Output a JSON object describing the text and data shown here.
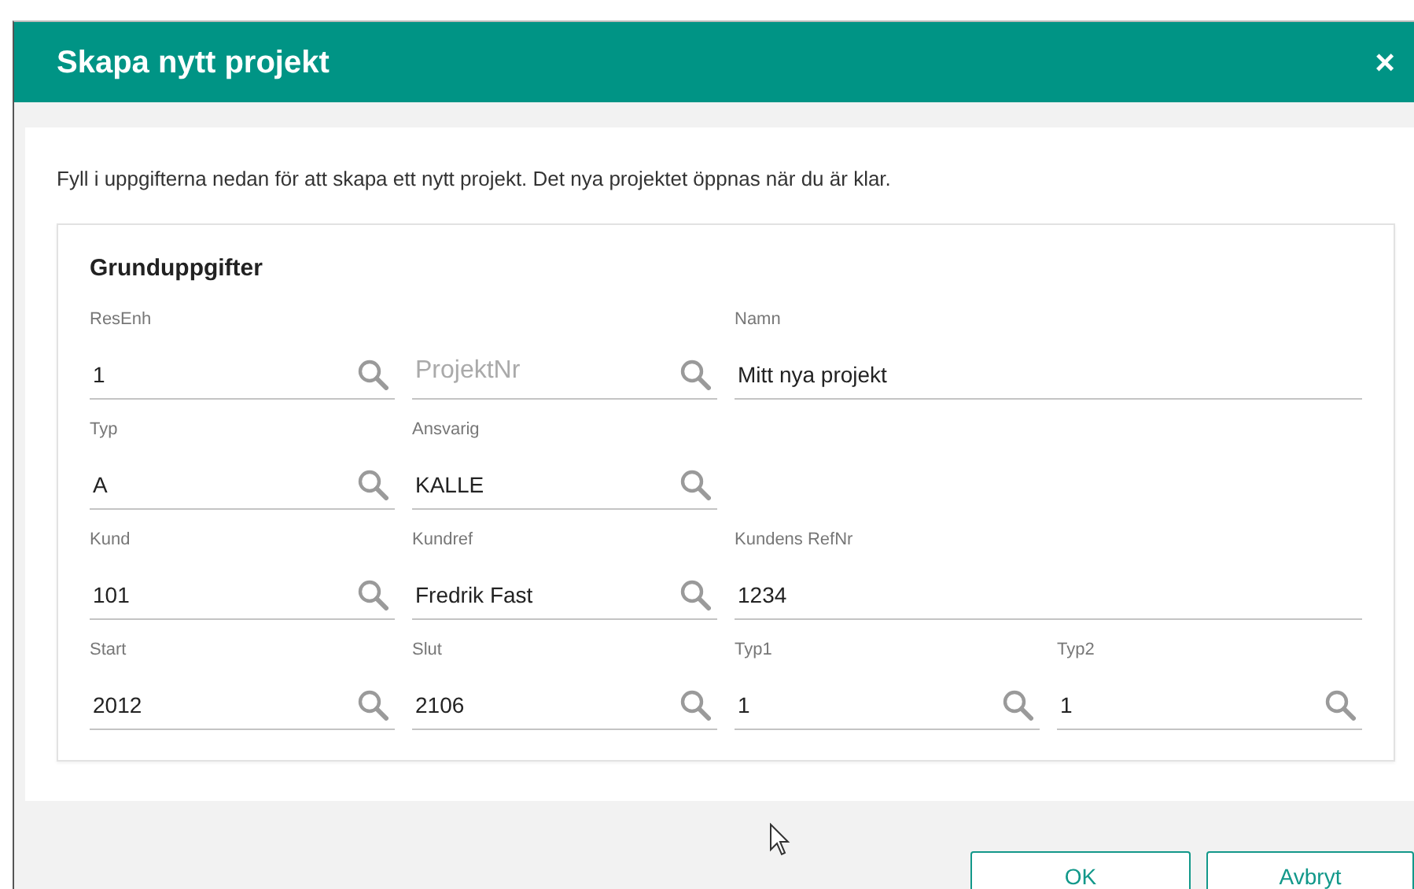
{
  "dialog": {
    "title": "Skapa nytt projekt",
    "close": "×",
    "intro": "Fyll i uppgifterna nedan för att skapa ett nytt projekt. Det nya projektet öppnas när du är klar.",
    "section": {
      "title": "Grunduppgifter",
      "rows": [
        [
          {
            "label": "ResEnh",
            "value": "1",
            "lookup": true,
            "wide": false
          },
          {
            "placeholder": "ProjektNr",
            "lookup": true,
            "wide": false
          },
          {
            "label": "Namn",
            "value": "Mitt nya projekt",
            "lookup": false,
            "wide": true
          }
        ],
        [
          {
            "label": "Typ",
            "value": "A",
            "lookup": true,
            "wide": false
          },
          {
            "label": "Ansvarig",
            "value": "KALLE",
            "lookup": true,
            "wide": false
          }
        ],
        [
          {
            "label": "Kund",
            "value": "101",
            "lookup": true,
            "wide": false
          },
          {
            "label": "Kundref",
            "value": "Fredrik Fast",
            "lookup": true,
            "wide": false
          },
          {
            "label": "Kundens RefNr",
            "value": "1234",
            "lookup": false,
            "wide": true
          }
        ],
        [
          {
            "label": "Start",
            "value": "2012",
            "lookup": true,
            "wide": false
          },
          {
            "label": "Slut",
            "value": "2106",
            "lookup": true,
            "wide": false
          },
          {
            "label": "Typ1",
            "value": "1",
            "lookup": true,
            "wide": false
          },
          {
            "label": "Typ2",
            "value": "1",
            "lookup": true,
            "wide": false
          }
        ]
      ]
    },
    "buttons": [
      "OK",
      "Avbryt"
    ]
  }
}
